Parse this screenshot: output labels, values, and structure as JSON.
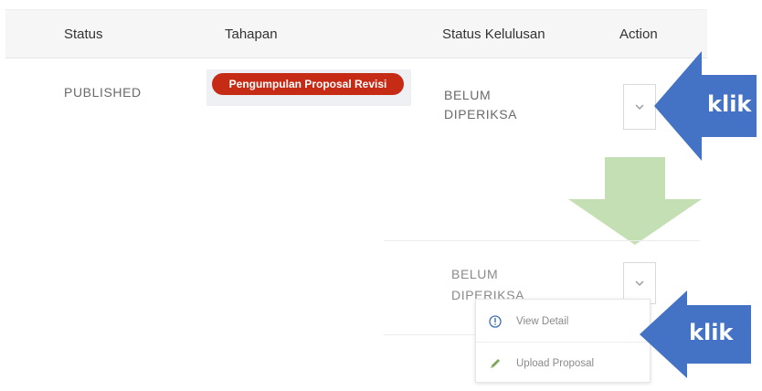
{
  "table": {
    "headers": {
      "status": "Status",
      "tahapan": "Tahapan",
      "status_kelulusan": "Status Kelulusan",
      "action": "Action"
    },
    "row": {
      "status": "PUBLISHED",
      "tahapan_badge": "Pengumpulan Proposal Revisi",
      "kelulusan_line1": "BELUM",
      "kelulusan_line2": "DIPERIKSA"
    }
  },
  "second_view": {
    "kelulusan_line1": "BELUM",
    "kelulusan_line2": "DIPERIKSA"
  },
  "dropdown_menu": {
    "items": [
      {
        "label": "View Detail",
        "icon": "info-circle-icon"
      },
      {
        "label": "Upload Proposal",
        "icon": "pencil-icon"
      }
    ]
  },
  "annotations": {
    "callout_top": "klik",
    "callout_bottom": "klik"
  },
  "colors": {
    "badge": "#c62b16",
    "callout": "#4472c4",
    "down_arrow": "#c5dfb4",
    "info_icon": "#3b6fb6",
    "pencil_icon": "#7aa75c"
  }
}
